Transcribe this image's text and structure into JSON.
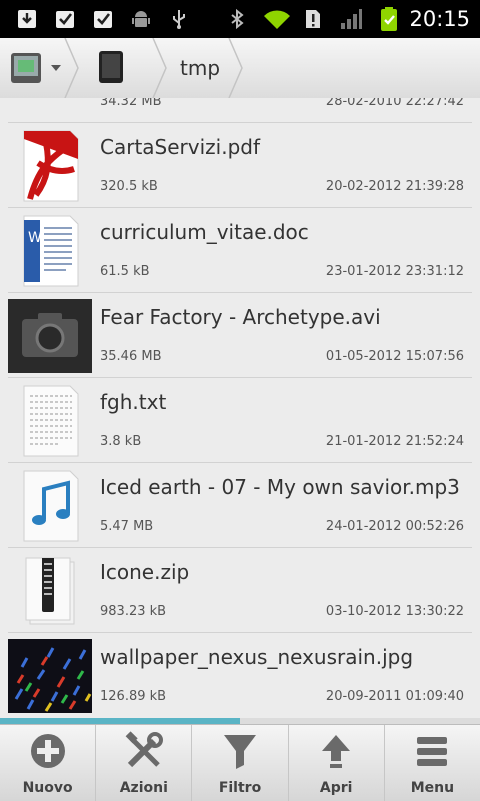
{
  "status_bar": {
    "time": "20:15",
    "icons": [
      "download-icon",
      "check-icon",
      "check-icon",
      "android-icon",
      "usb-icon",
      "bluetooth-icon",
      "wifi-icon",
      "alert-icon",
      "signal-icon",
      "battery-icon"
    ]
  },
  "breadcrumb": {
    "current_folder": "tmp"
  },
  "files": [
    {
      "name": "",
      "size": "34.32 MB",
      "date": "28-02-2010 22:27:42",
      "icon": "folder-partial"
    },
    {
      "name": "CartaServizi.pdf",
      "size": "320.5 kB",
      "date": "20-02-2012 21:39:28",
      "icon": "pdf-icon"
    },
    {
      "name": "curriculum_vitae.doc",
      "size": "61.5 kB",
      "date": "23-01-2012 23:31:12",
      "icon": "doc-icon"
    },
    {
      "name": "Fear Factory - Archetype.avi",
      "size": "35.46 MB",
      "date": "01-05-2012 15:07:56",
      "icon": "camera-icon"
    },
    {
      "name": "fgh.txt",
      "size": "3.8 kB",
      "date": "21-01-2012 21:52:24",
      "icon": "text-file-icon"
    },
    {
      "name": "Iced earth - 07 - My own savior.mp3",
      "size": "5.47 MB",
      "date": "24-01-2012 00:52:26",
      "icon": "music-icon"
    },
    {
      "name": "Icone.zip",
      "size": "983.23 kB",
      "date": "03-10-2012 13:30:22",
      "icon": "zip-icon"
    },
    {
      "name": "wallpaper_nexus_nexusrain.jpg",
      "size": "126.89 kB",
      "date": "20-09-2011 01:09:40",
      "icon": "image-thumbnail"
    }
  ],
  "scroll_progress": 0.5,
  "toolbar": {
    "new_label": "Nuovo",
    "actions_label": "Azioni",
    "filter_label": "Filtro",
    "open_label": "Apri",
    "menu_label": "Menu"
  }
}
